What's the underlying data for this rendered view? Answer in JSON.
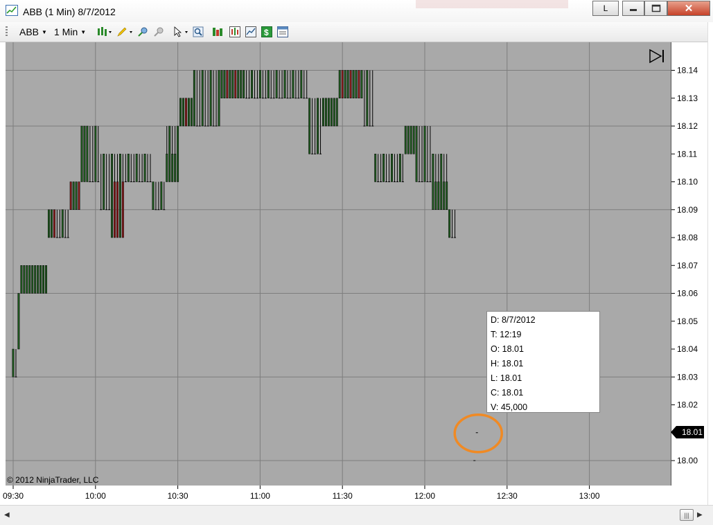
{
  "window": {
    "title": "ABB (1 Min)  8/7/2012",
    "buttons": {
      "link": "L",
      "minimize": "—",
      "maximize": "□",
      "close": "✕"
    }
  },
  "toolbar": {
    "instrument": "ABB",
    "interval": "1 Min",
    "icons": [
      "bar-style-icon",
      "draw-pencil-icon",
      "zoom-in-icon",
      "zoom-out-icon",
      "cursor-icon",
      "magnify-icon",
      "strategies-icon",
      "indicators-icon",
      "chart-trader-icon",
      "money-icon",
      "properties-icon"
    ]
  },
  "chart": {
    "copyright": "© 2012 NinjaTrader, LLC",
    "price_ticks": [
      "18.14",
      "18.13",
      "18.12",
      "18.11",
      "18.10",
      "18.09",
      "18.08",
      "18.07",
      "18.06",
      "18.05",
      "18.04",
      "18.03",
      "18.02",
      "18.01",
      "18.00"
    ],
    "time_ticks": [
      "09:30",
      "10:00",
      "10:30",
      "11:00",
      "11:30",
      "12:00",
      "12:30",
      "13:00"
    ],
    "last_price": "18.01",
    "colors": {
      "background": "#a9a9a9",
      "up": "#1f5a1f",
      "down": "#8b1a1a",
      "highlight": "#f08a24"
    }
  },
  "chart_data": {
    "type": "candlestick",
    "interval": "1 Min",
    "date": "8/7/2012",
    "ylim": [
      18.0,
      18.14
    ],
    "xlim": [
      "09:30",
      "13:00"
    ],
    "grid": true
  },
  "databox": {
    "date": "D: 8/7/2012",
    "time": "T: 12:19",
    "open": "O: 18.01",
    "high": "H: 18.01",
    "low": "L: 18.01",
    "close": "C: 18.01",
    "volume": "V: 45,000"
  }
}
